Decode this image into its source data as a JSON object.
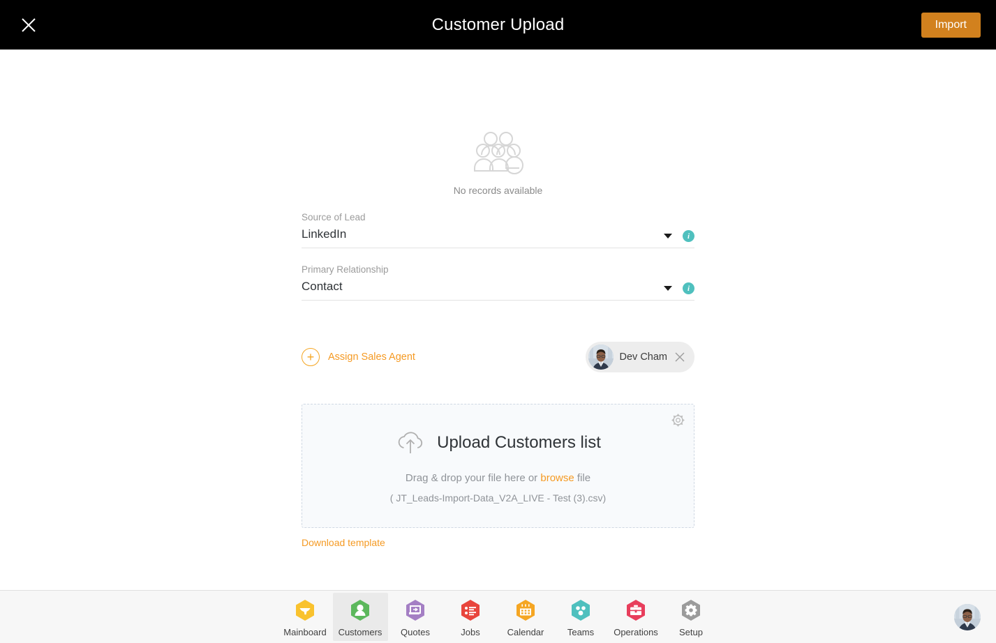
{
  "header": {
    "title": "Customer Upload",
    "close_icon": "close-icon",
    "import_label": "Import"
  },
  "empty_state": {
    "icon": "people-group-icon",
    "text": "No records available"
  },
  "fields": [
    {
      "label": "Source of Lead",
      "value": "LinkedIn",
      "caret": "chevron-down-icon",
      "info": "i"
    },
    {
      "label": "Primary Relationship",
      "value": "Contact",
      "caret": "chevron-down-icon",
      "info": "i"
    }
  ],
  "assign": {
    "plus": "+",
    "label": "Assign Sales Agent",
    "agent_name": "Dev Cham",
    "remove_icon": "close-icon"
  },
  "upload": {
    "gear_icon": "gear-icon",
    "cloud_icon": "cloud-upload-icon",
    "title": "Upload Customers list",
    "drag_prefix": "Drag & drop your file here or ",
    "browse_label": "browse",
    "drag_suffix": " file",
    "file_name": "( JT_Leads-Import-Data_V2A_LIVE - Test (3).csv)",
    "download_template": "Download template"
  },
  "bottom_nav": {
    "items": [
      {
        "label": "Mainboard",
        "icon": "mainboard-icon",
        "color": "#F9C22E",
        "active": false
      },
      {
        "label": "Customers",
        "icon": "customers-icon",
        "color": "#5CB85C",
        "active": true
      },
      {
        "label": "Quotes",
        "icon": "quotes-icon",
        "color": "#A островов",
        "active": false
      },
      {
        "label": "Jobs",
        "icon": "jobs-icon",
        "color": "#E8453C",
        "active": false
      },
      {
        "label": "Calendar",
        "icon": "calendar-icon",
        "color": "#F5A623",
        "active": false
      },
      {
        "label": "Teams",
        "icon": "teams-icon",
        "color": "#4FC0BE",
        "active": false
      },
      {
        "label": "Operations",
        "icon": "operations-icon",
        "color": "#E83E5C",
        "active": false
      },
      {
        "label": "Setup",
        "icon": "setup-icon",
        "color": "#9B9B9B",
        "active": false
      }
    ],
    "avatar": "user-avatar"
  },
  "colors": {
    "header_bg": "#000000",
    "accent_orange": "#F59A23",
    "import_btn": "#D2811E",
    "info_teal": "#4FC0BE",
    "upload_bg": "#F8FAFC"
  }
}
